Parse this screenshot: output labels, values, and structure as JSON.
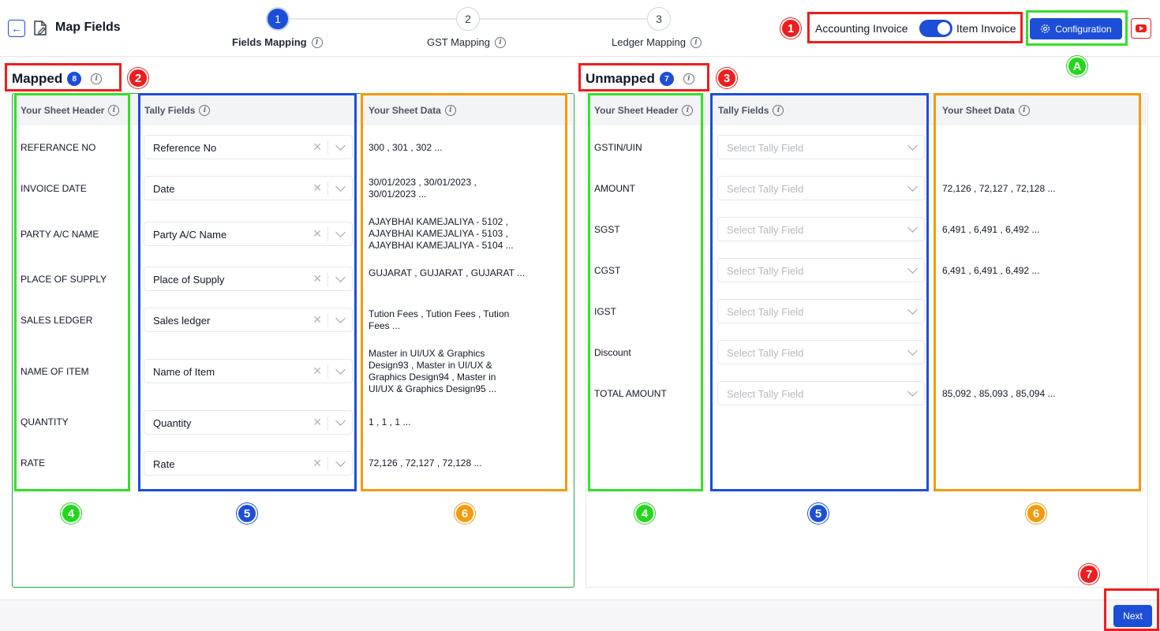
{
  "header": {
    "back_icon": "arrow-left-icon",
    "page_icon": "file-edit-icon",
    "title": "Map Fields"
  },
  "stepper": {
    "steps": [
      {
        "number": "1",
        "label": "Fields Mapping",
        "active": true
      },
      {
        "number": "2",
        "label": "GST Mapping",
        "active": false
      },
      {
        "number": "3",
        "label": "Ledger Mapping",
        "active": false
      }
    ]
  },
  "invoice_toggle": {
    "left_label": "Accounting Invoice",
    "right_label": "Item Invoice",
    "state": "Item Invoice"
  },
  "configuration_label": "Configuration",
  "youtube_icon": "youtube-icon",
  "annotations": {
    "one": "1",
    "two": "2",
    "three": "3",
    "four": "4",
    "five": "5",
    "six": "6",
    "seven": "7",
    "a": "A"
  },
  "mapped": {
    "title": "Mapped",
    "count": "8",
    "columns": [
      "Your Sheet Header",
      "Tally Fields",
      "Your Sheet Data"
    ],
    "rows": [
      {
        "header": "REFERANCE NO",
        "field": "Reference No",
        "data": "300 , 301 , 302 ..."
      },
      {
        "header": "INVOICE DATE",
        "field": "Date",
        "data": "30/01/2023 , 30/01/2023 , 30/01/2023 ..."
      },
      {
        "header": "PARTY A/C NAME",
        "field": "Party A/C Name",
        "data": "AJAYBHAI KAMEJALIYA - 5102 , AJAYBHAI KAMEJALIYA - 5103 , AJAYBHAI KAMEJALIYA - 5104 ..."
      },
      {
        "header": "PLACE OF SUPPLY",
        "field": "Place of Supply",
        "data": "GUJARAT , GUJARAT , GUJARAT ..."
      },
      {
        "header": "SALES LEDGER",
        "field": "Sales ledger",
        "data": "Tution Fees , Tution Fees , Tution Fees ..."
      },
      {
        "header": "NAME OF ITEM",
        "field": "Name of Item",
        "data": "Master in UI/UX & Graphics Design93 , Master in UI/UX & Graphics Design94 , Master in UI/UX & Graphics Design95 ..."
      },
      {
        "header": "QUANTITY",
        "field": "Quantity",
        "data": "1 , 1 , 1 ..."
      },
      {
        "header": "RATE",
        "field": "Rate",
        "data": "72,126 , 72,127 , 72,128 ..."
      }
    ]
  },
  "unmapped": {
    "title": "Unmapped",
    "count": "7",
    "columns": [
      "Your Sheet Header",
      "Tally Fields",
      "Your Sheet Data"
    ],
    "placeholder": "Select Tally Field",
    "rows": [
      {
        "header": "GSTIN/UIN",
        "data": ""
      },
      {
        "header": "AMOUNT",
        "data": "72,126 , 72,127 , 72,128 ..."
      },
      {
        "header": "SGST",
        "data": "6,491 , 6,491 , 6,492 ..."
      },
      {
        "header": "CGST",
        "data": "6,491 , 6,491 , 6,492 ..."
      },
      {
        "header": "IGST",
        "data": ""
      },
      {
        "header": "Discount",
        "data": ""
      },
      {
        "header": "TOTAL AMOUNT",
        "data": "85,092 , 85,093 , 85,094 ..."
      }
    ]
  },
  "footer": {
    "next_label": "Next"
  },
  "colors": {
    "primary": "#1d4ed8",
    "annotation_red": "#ef1d1d",
    "annotation_green": "#33e02a",
    "annotation_orange": "#f59a0b"
  }
}
